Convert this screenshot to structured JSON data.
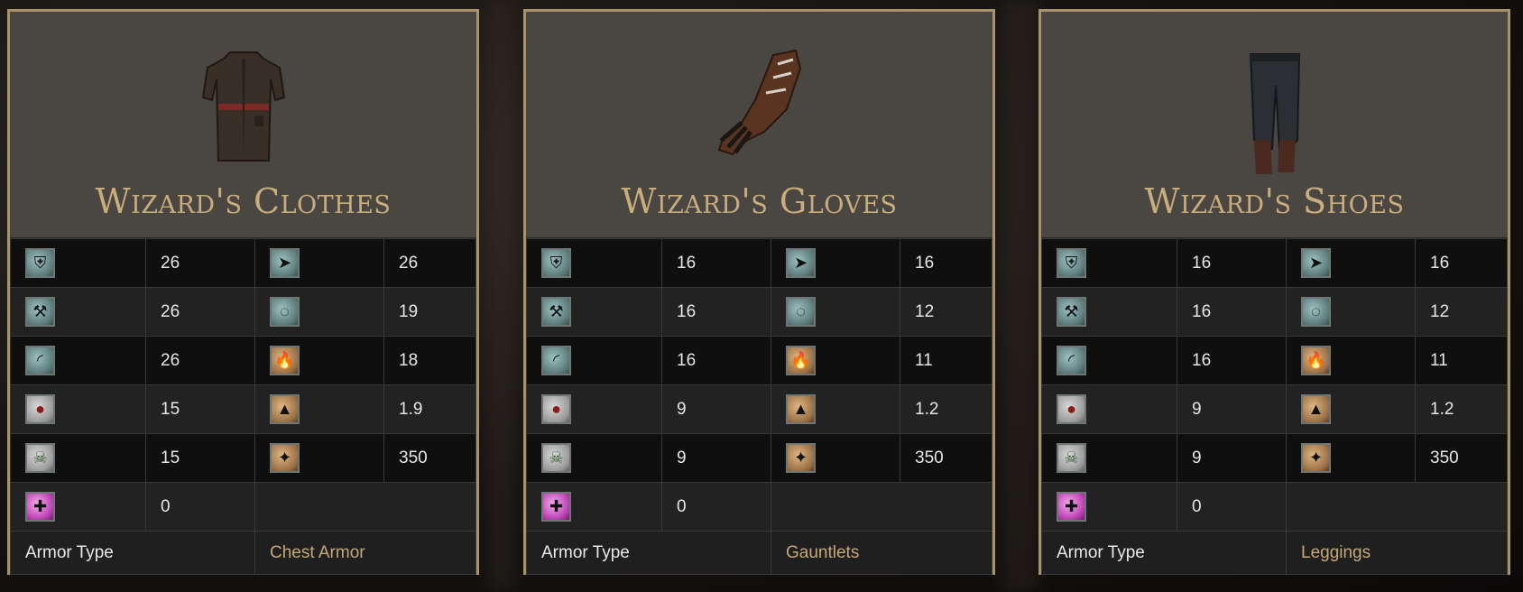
{
  "cards": [
    {
      "title": "Wizard's Clothes",
      "item_icon": "chest-armor-icon",
      "rows": [
        {
          "icon1": "physical-armor-icon",
          "v1": "26",
          "icon2": "pierce-defense-icon",
          "v2": "26"
        },
        {
          "icon1": "strike-defense-icon",
          "v1": "26",
          "icon2": "magic-defense-icon",
          "v2": "19"
        },
        {
          "icon1": "slash-defense-icon",
          "v1": "26",
          "icon2": "fire-defense-icon",
          "v2": "18"
        },
        {
          "icon1": "blood-resist-icon",
          "v1": "15",
          "icon2": "weight-icon",
          "v2": "1.9"
        },
        {
          "icon1": "poison-resist-icon",
          "v1": "15",
          "icon2": "durability-icon",
          "v2": "350"
        },
        {
          "icon1": "curse-resist-icon",
          "v1": "0",
          "icon2": "",
          "v2": ""
        }
      ],
      "type_label": "Armor Type",
      "type_value": "Chest Armor"
    },
    {
      "title": "Wizard's Gloves",
      "item_icon": "gauntlets-icon",
      "rows": [
        {
          "icon1": "physical-armor-icon",
          "v1": "16",
          "icon2": "pierce-defense-icon",
          "v2": "16"
        },
        {
          "icon1": "strike-defense-icon",
          "v1": "16",
          "icon2": "magic-defense-icon",
          "v2": "12"
        },
        {
          "icon1": "slash-defense-icon",
          "v1": "16",
          "icon2": "fire-defense-icon",
          "v2": "11"
        },
        {
          "icon1": "blood-resist-icon",
          "v1": "9",
          "icon2": "weight-icon",
          "v2": "1.2"
        },
        {
          "icon1": "poison-resist-icon",
          "v1": "9",
          "icon2": "durability-icon",
          "v2": "350"
        },
        {
          "icon1": "curse-resist-icon",
          "v1": "0",
          "icon2": "",
          "v2": ""
        }
      ],
      "type_label": "Armor Type",
      "type_value": "Gauntlets"
    },
    {
      "title": "Wizard's Shoes",
      "item_icon": "leggings-icon",
      "rows": [
        {
          "icon1": "physical-armor-icon",
          "v1": "16",
          "icon2": "pierce-defense-icon",
          "v2": "16"
        },
        {
          "icon1": "strike-defense-icon",
          "v1": "16",
          "icon2": "magic-defense-icon",
          "v2": "12"
        },
        {
          "icon1": "slash-defense-icon",
          "v1": "16",
          "icon2": "fire-defense-icon",
          "v2": "11"
        },
        {
          "icon1": "blood-resist-icon",
          "v1": "9",
          "icon2": "weight-icon",
          "v2": "1.2"
        },
        {
          "icon1": "poison-resist-icon",
          "v1": "9",
          "icon2": "durability-icon",
          "v2": "350"
        },
        {
          "icon1": "curse-resist-icon",
          "v1": "0",
          "icon2": "",
          "v2": ""
        }
      ],
      "type_label": "Armor Type",
      "type_value": "Leggings"
    }
  ],
  "colors": {
    "border": "#a8926b",
    "title": "#c9ad7c",
    "type_value": "#c6a779"
  }
}
